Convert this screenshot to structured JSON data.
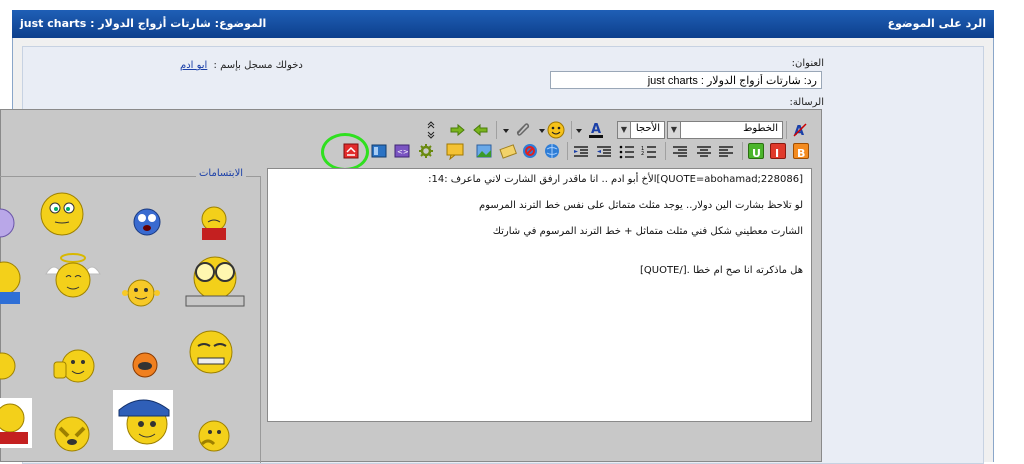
{
  "titlebar": {
    "reply_title": "الرد على الموضوع",
    "topic_label": "الموضوع:",
    "topic_name": "شارتات أزواج الدولار : just charts"
  },
  "form": {
    "title_label": "العنوان:",
    "title_value": "رد: شارتات أزواج الدولار : just charts",
    "logged_in_text": "دخولك مسجل بإسم :",
    "username": "ابو ادم",
    "message_label": "الرسالة:"
  },
  "toolbar": {
    "font_select": "الخطوط",
    "size_select": "الأحجا"
  },
  "smilies": {
    "legend": "الابتسامات"
  },
  "message": {
    "lines": [
      "[QUOTE=abohamad;228086]الأخ  أبو ادم ..   انا ماقدر ارفق الشارت لاني ماعرف :14:",
      "لو تلاحظ بشارت الين دولار..  يوجد مثلث متماثل  على نفس خط الترند المرسوم",
      "الشارت معطيني  شكل فني مثلث متماثل + خط الترند المرسوم في شارتك",
      "هل ماذكرته انا صح ام خطا .[/QUOTE]"
    ]
  }
}
